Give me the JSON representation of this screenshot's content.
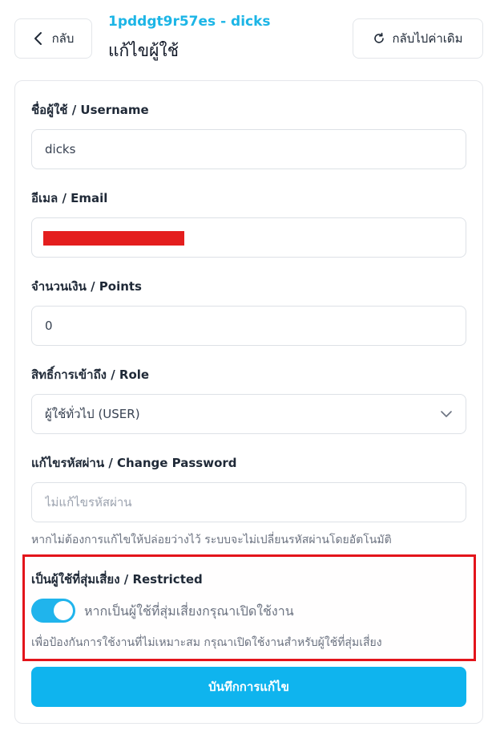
{
  "header": {
    "back_label": "กลับ",
    "subtitle": "1pddgt9r57es - dicks",
    "title": "แก้ไขผู้ใช้",
    "reset_label": "กลับไปค่าเดิม"
  },
  "form": {
    "username": {
      "label": "ชื่อผู้ใช้ / Username",
      "value": "dicks"
    },
    "email": {
      "label": "อีเมล / Email",
      "value": ""
    },
    "points": {
      "label": "จำนวนเงิน / Points",
      "value": "0"
    },
    "role": {
      "label": "สิทธิ์การเข้าถึง / Role",
      "selected": "ผู้ใช้ทั่วไป (USER)"
    },
    "password": {
      "label": "แก้ไขรหัสผ่าน / Change Password",
      "placeholder": "ไม่แก้ไขรหัสผ่าน",
      "hint": "หากไม่ต้องการแก้ไขให้ปล่อยว่างไว้ ระบบจะไม่เปลี่ยนรหัสผ่านโดยอัตโนมัติ"
    },
    "restricted": {
      "label": "เป็นผู้ใช้ที่สุ่มเสี่ยง / Restricted",
      "toggle_label": "หากเป็นผู้ใช้ที่สุ่มเสี่ยงกรุณาเปิดใช้งาน",
      "hint": "เพื่อป้องกันการใช้งานที่ไม่เหมาะสม กรุณาเปิดใช้งานสำหรับผู้ใช้ที่สุ่มเสี่ยง",
      "enabled": true
    },
    "save_label": "บันทึกการแก้ไข"
  },
  "colors": {
    "accent": "#0fb4ee",
    "subtitle": "#1cb5e6",
    "highlight_border": "#e3141b"
  },
  "icons": {
    "back": "chevron-left-icon",
    "reset": "refresh-icon",
    "select": "chevron-down-icon"
  }
}
